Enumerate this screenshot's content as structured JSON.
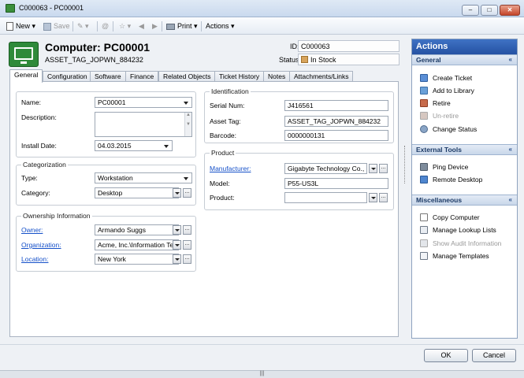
{
  "window": {
    "title": "C000063 - PC00001",
    "minimize": "–",
    "maximize": "□",
    "close": "✕"
  },
  "toolbar": {
    "new": "New",
    "save": "Save",
    "print": "Print",
    "actions": "Actions"
  },
  "header": {
    "title": "Computer: PC00001",
    "asset_tag": "ASSET_TAG_JOPWN_884232",
    "id_label": "ID:",
    "id_value": "C000063",
    "status_label": "Status:",
    "status_value": "In Stock"
  },
  "tabs": [
    "General",
    "Configuration",
    "Software",
    "Finance",
    "Related Objects",
    "Ticket History",
    "Notes",
    "Attachments/Links"
  ],
  "general": {
    "name_label": "Name:",
    "name_value": "PC00001",
    "description_label": "Description:",
    "description_value": "",
    "install_date_label": "Install Date:",
    "install_date_value": "04.03.2015"
  },
  "categorization": {
    "legend": "Categorization",
    "type_label": "Type:",
    "type_value": "Workstation",
    "category_label": "Category:",
    "category_value": "Desktop"
  },
  "ownership": {
    "legend": "Ownership Information",
    "owner_label": "Owner:",
    "owner_value": "Armando Suggs",
    "organization_label": "Organization:",
    "organization_value": "Acme, Inc.\\Information Tec",
    "location_label": "Location:",
    "location_value": "New York"
  },
  "identification": {
    "legend": "Identification",
    "serial_label": "Serial Num:",
    "serial_value": "J416561",
    "asset_label": "Asset Tag:",
    "asset_value": "ASSET_TAG_JOPWN_884232",
    "barcode_label": "Barcode:",
    "barcode_value": "0000000131"
  },
  "product": {
    "legend": "Product",
    "manufacturer_label": "Manufacturer:",
    "manufacturer_value": "Gigabyte Technology Co., Lt",
    "model_label": "Model:",
    "model_value": "P55-US3L",
    "product_label": "Product:",
    "product_value": ""
  },
  "actions_panel": {
    "title": "Actions",
    "general_head": "General",
    "general_items": [
      "Create Ticket",
      "Add to Library",
      "Retire",
      "Un-retire",
      "Change Status"
    ],
    "external_head": "External Tools",
    "external_items": [
      "Ping Device",
      "Remote Desktop"
    ],
    "misc_head": "Miscellaneous",
    "misc_items": [
      "Copy Computer",
      "Manage Lookup Lists",
      "Show Audit Information",
      "Manage Templates"
    ],
    "chevron": "«"
  },
  "footer": {
    "ok": "OK",
    "cancel": "Cancel",
    "grip": "|||"
  }
}
